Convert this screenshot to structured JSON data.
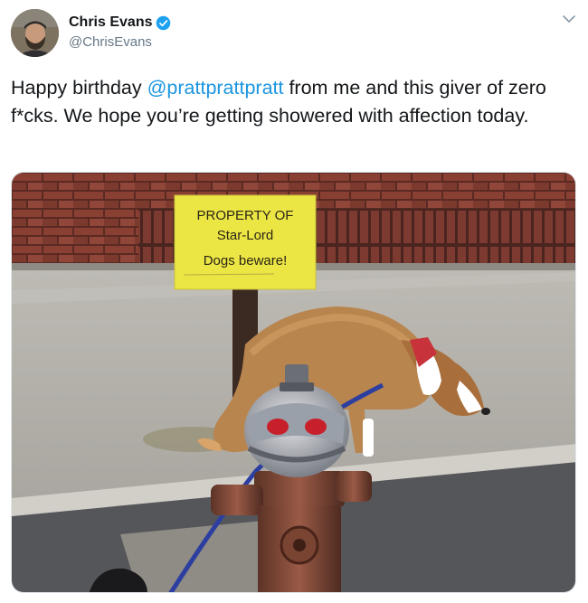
{
  "tweet": {
    "author_name": "Chris Evans",
    "author_handle": "@ChrisEvans",
    "verified": true,
    "text_before_mention": "Happy birthday ",
    "mention": "@prattprattpratt",
    "text_after_mention": " from me and this giver of zero f*cks. We hope you’re getting showered with affection today."
  },
  "media": {
    "sign": {
      "line1": "PROPERTY OF",
      "line2": "Star-Lord",
      "line3": "Dogs beware!"
    }
  },
  "icons": {
    "verified": "verified-badge-icon",
    "menu": "chevron-down-icon"
  },
  "colors": {
    "link": "#1b95e0",
    "verified_badge": "#1da1f2",
    "text": "#14171a",
    "secondary_text": "#657786"
  }
}
